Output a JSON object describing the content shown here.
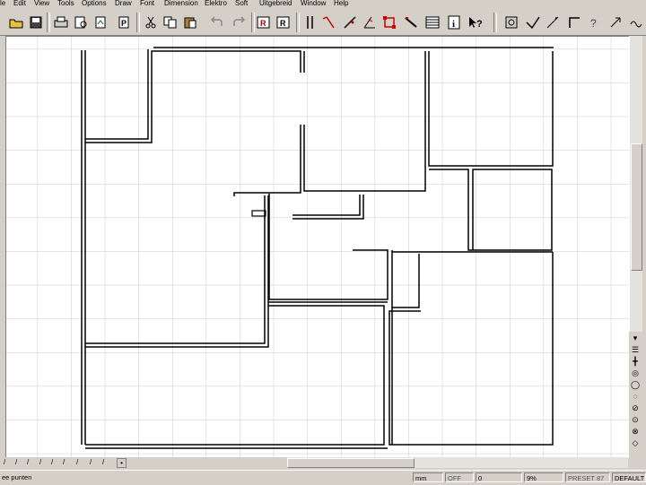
{
  "menu": [
    "le",
    "Edit",
    "View",
    "Tools",
    "Options",
    "Draw",
    "Font",
    "Dimension",
    "Elektro",
    "Soft",
    "Uitgebreid",
    "Window",
    "Help"
  ],
  "toolbar_icons": [
    "open-folder-icon",
    "save-icon",
    "print-icon",
    "print-preview-icon",
    "export-icon",
    "cut-icon",
    "copy-icon",
    "paste-icon",
    "undo-icon",
    "redo-icon",
    "text-r-icon",
    "text-r2-icon",
    "parallel-lines-icon",
    "arrow-line-icon",
    "draw-line-icon",
    "angle-icon",
    "select-rectangle-icon",
    "knife-icon",
    "layers-icon",
    "info-icon",
    "help-pointer-icon",
    "zoom-window-icon",
    "measure-icon",
    "line-tool-icon",
    "rectangle-icon",
    "question-icon",
    "arrow-icon"
  ],
  "side_icons": [
    "chevron-down-icon",
    "align-icon",
    "snap-cross-icon",
    "snap-point-icon",
    "circle-icon",
    "circle-2-icon",
    "circle-3-icon",
    "circle-4-icon",
    "snap-x-icon"
  ],
  "tabs": [
    "/",
    "/",
    "/",
    "/",
    "/",
    "/",
    "/",
    "/",
    "/"
  ],
  "status": {
    "message": "ee punten",
    "unit": "mm",
    "off": "OFF",
    "value": "0",
    "zoom": "9%",
    "preset": "PRESET 87",
    "layer": "DEFAULT"
  }
}
